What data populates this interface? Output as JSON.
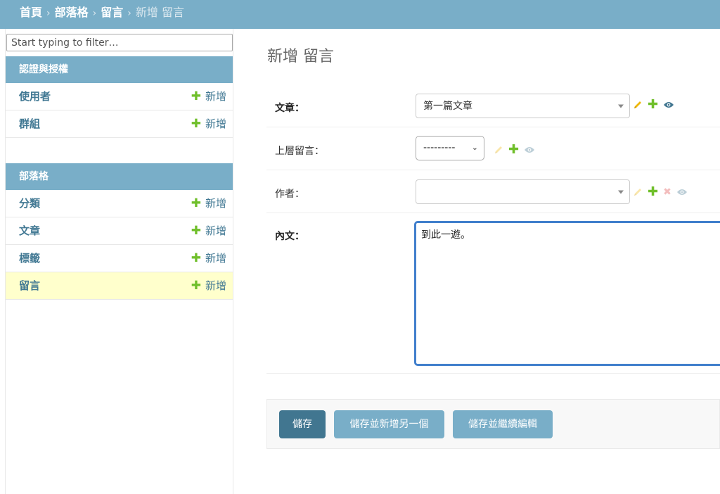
{
  "breadcrumbs": {
    "home": "首頁",
    "app": "部落格",
    "model": "留言",
    "current": "新增 留言",
    "separator": "›"
  },
  "sidebar": {
    "filter_placeholder": "Start typing to filter…",
    "modules": [
      {
        "caption": "認證與授權",
        "models": [
          {
            "name": "使用者",
            "add": "新增"
          },
          {
            "name": "群組",
            "add": "新增"
          }
        ]
      },
      {
        "caption": "部落格",
        "models": [
          {
            "name": "分類",
            "add": "新增"
          },
          {
            "name": "文章",
            "add": "新增"
          },
          {
            "name": "標籤",
            "add": "新增"
          },
          {
            "name": "留言",
            "add": "新增"
          }
        ]
      }
    ],
    "current_model": "留言"
  },
  "page_title": "新增 留言",
  "form": {
    "post": {
      "label": "文章：",
      "value": "第一篇文章"
    },
    "parent": {
      "label": "上層留言：",
      "value": "---------"
    },
    "author": {
      "label": "作者：",
      "value": ""
    },
    "body": {
      "label": "內文：",
      "value": "到此一遊。"
    }
  },
  "buttons": {
    "save": "儲存",
    "save_add_another": "儲存並新增另一個",
    "save_continue": "儲存並繼續編輯"
  },
  "colors": {
    "header": "#79aec8",
    "primary_button": "#417690",
    "link": "#417893",
    "add_plus": "#70bf2b",
    "current_row": "#ffffcc",
    "focus_border": "#417fcc"
  },
  "icons": [
    "pencil-icon",
    "plus-icon",
    "eye-icon",
    "cross-icon",
    "chevron-down-icon"
  ]
}
